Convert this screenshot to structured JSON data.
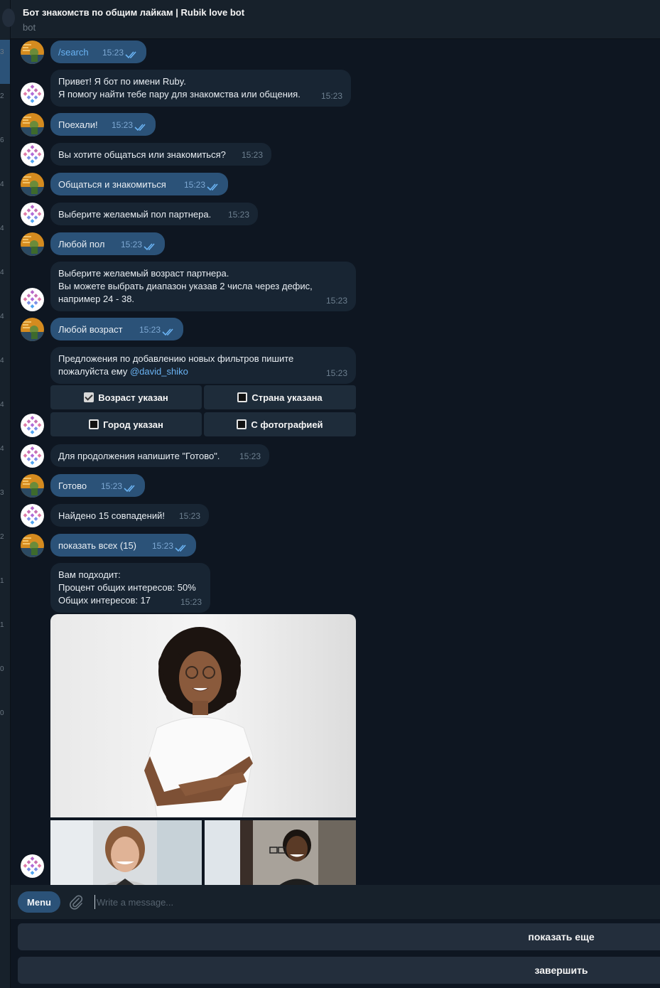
{
  "chat": {
    "title": "Бот знакомств по общим лайкам | Rubik love bot",
    "subtitle": "bot"
  },
  "sidebar_counts": [
    "3",
    "2",
    "6",
    "4",
    "4",
    "4",
    "4",
    "4",
    "4",
    "4",
    "3",
    "2",
    "1",
    "1",
    "0",
    "0"
  ],
  "messages": [
    {
      "from": "user",
      "text": "/search",
      "time": "15:23"
    },
    {
      "from": "bot",
      "text": "Привет! Я бот по имени Ruby.\nЯ помогу найти тебе пару для знакомства или общения.",
      "time": "15:23"
    },
    {
      "from": "user",
      "text": "Поехали!",
      "time": "15:23"
    },
    {
      "from": "bot",
      "text": "Вы хотите общаться или знакомиться?",
      "time": "15:23"
    },
    {
      "from": "user",
      "text": "Общаться и знакомиться",
      "time": "15:23"
    },
    {
      "from": "bot",
      "text": "Выберите желаемый пол партнера.",
      "time": "15:23"
    },
    {
      "from": "user",
      "text": "Любой пол",
      "time": "15:23"
    },
    {
      "from": "bot",
      "text": "Выберите желаемый возраст партнера.\nВы можете выбрать диапазон указав 2 числа через дефис,\nнапример 24 - 38.",
      "time": "15:23"
    },
    {
      "from": "user",
      "text": "Любой возраст",
      "time": "15:23"
    },
    {
      "from": "bot",
      "text_before_link": "Предложения по добавлению новых фильтров пишите\nпожалуйста ему ",
      "link": "@david_shiko",
      "time": "15:23"
    },
    {
      "from": "bot",
      "text": "Для продолжения напишите \"Готово\".",
      "time": "15:23"
    },
    {
      "from": "user",
      "text": "Готово",
      "time": "15:23"
    },
    {
      "from": "bot",
      "text": "Найдено 15 совпадений!",
      "time": "15:23"
    },
    {
      "from": "user",
      "text": "показать всех (15)",
      "time": "15:23"
    },
    {
      "from": "bot",
      "text": "Вам подходит:\nПроцент общих интересов: 50%\nОбщих интересов: 17",
      "time": "15:23"
    }
  ],
  "inline_keyboard": [
    {
      "label": "Возраст указан",
      "checked": true
    },
    {
      "label": "Страна указана",
      "checked": false
    },
    {
      "label": "Город указан",
      "checked": false
    },
    {
      "label": "С фотографией",
      "checked": false
    }
  ],
  "compose": {
    "menu_label": "Menu",
    "placeholder": "Write a message..."
  },
  "reply_keyboard": [
    {
      "label": "показать еще"
    },
    {
      "label": "завершить"
    }
  ],
  "colors": {
    "background": "#0e1621",
    "bubble_in": "#182533",
    "bubble_out": "#2b5278",
    "accent": "#6ab3f3"
  }
}
